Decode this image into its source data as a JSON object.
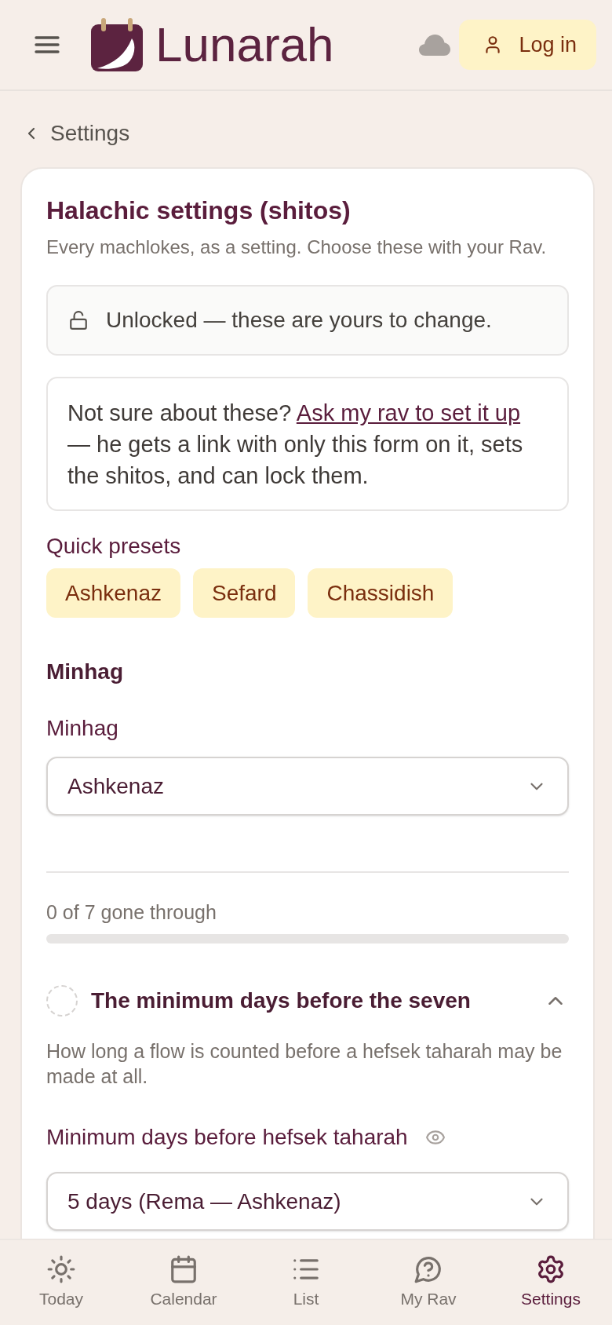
{
  "header": {
    "brand": "Lunarah",
    "login_button": "Log in"
  },
  "back_link": "Settings",
  "card": {
    "title": "Halachic settings (shitos)",
    "subtitle": "Every machlokes, as a setting. Choose these with your Rav.",
    "lock_notice": {
      "locked": false,
      "text": "Unlocked — these are yours to change."
    },
    "help_note": {
      "text_before": "Not sure about these?",
      "link": "Ask my rav to set it up",
      "text_after": "— he gets a link with only this form on it, sets the shitos, and can lock them."
    },
    "presets": {
      "label": "Quick presets",
      "options": [
        "Ashkenaz",
        "Sefard",
        "Chassidish"
      ]
    },
    "minhag": {
      "heading": "Minhag",
      "field_label": "Minhag",
      "value": "Ashkenaz"
    },
    "progress": {
      "text": "0 of 7 gone through",
      "level": 0
    },
    "question": {
      "title": "The minimum days before the seven",
      "done": false,
      "expanded": true,
      "description": "How long a flow is counted before a hefsek taharah may be made at all.",
      "field_label": "Minimum days before hefsek taharah",
      "value": "5 days (Rema — Ashkenaz)"
    }
  },
  "nav": [
    {
      "label": "Today",
      "selected": false
    },
    {
      "label": "Calendar",
      "selected": false
    },
    {
      "label": "List",
      "selected": false
    },
    {
      "label": "My Rav",
      "selected": false
    },
    {
      "label": "Settings",
      "selected": true
    }
  ]
}
